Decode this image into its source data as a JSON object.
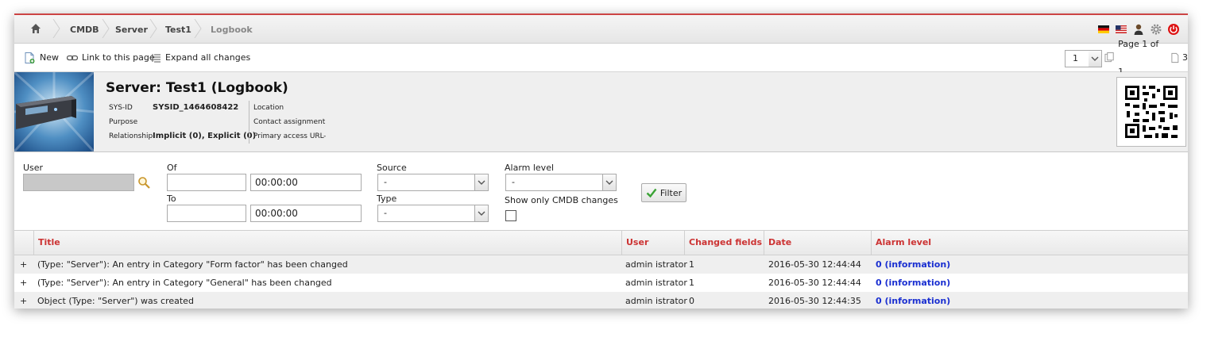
{
  "breadcrumb": {
    "items": [
      "CMDB",
      "Server",
      "Test1",
      "Logbook"
    ]
  },
  "toolbar": {
    "new_label": "New",
    "link_label": "Link to this page",
    "expand_label": "Expand all changes",
    "page_select_value": "1",
    "page_text": "Page 1 of 1",
    "page_count": "3"
  },
  "object": {
    "title": "Server: Test1 (Logbook)",
    "sysid_label": "SYS-ID",
    "sysid_value": "SYSID_1464608422",
    "purpose_label": "Purpose",
    "relationship_label": "Relationship",
    "relationship_value": "Implicit (0), Explicit (0)",
    "location_label": "Location",
    "contact_label": "Contact assignment",
    "url_label": "Primary access URL",
    "url_value": "-"
  },
  "filters": {
    "user_label": "User",
    "of_label": "Of",
    "to_label": "To",
    "of_time": "00:00:00",
    "to_time": "00:00:00",
    "source_label": "Source",
    "source_value": "-",
    "type_label": "Type",
    "type_value": "-",
    "alarm_label": "Alarm level",
    "alarm_value": "-",
    "cmdb_only_label": "Show only CMDB changes",
    "filter_button": "Filter"
  },
  "table": {
    "headers": [
      "Title",
      "User",
      "Changed fields",
      "Date",
      "Alarm level"
    ],
    "rows": [
      {
        "expand": "+",
        "title": "(Type: \"Server\"): An entry in Category \"Form factor\" has been changed",
        "user": "admin istrator",
        "changed": "1",
        "date": "2016-05-30 12:44:44",
        "alarm": "0 (information)"
      },
      {
        "expand": "+",
        "title": "(Type: \"Server\"): An entry in Category \"General\" has been changed",
        "user": "admin istrator",
        "changed": "1",
        "date": "2016-05-30 12:44:44",
        "alarm": "0 (information)"
      },
      {
        "expand": "+",
        "title": "Object (Type: \"Server\") was created",
        "user": "admin istrator",
        "changed": "0",
        "date": "2016-05-30 12:44:35",
        "alarm": "0 (information)"
      }
    ]
  },
  "colors": {
    "accent_red": "#cc3333",
    "alarm_blue": "#1a2fd1"
  }
}
